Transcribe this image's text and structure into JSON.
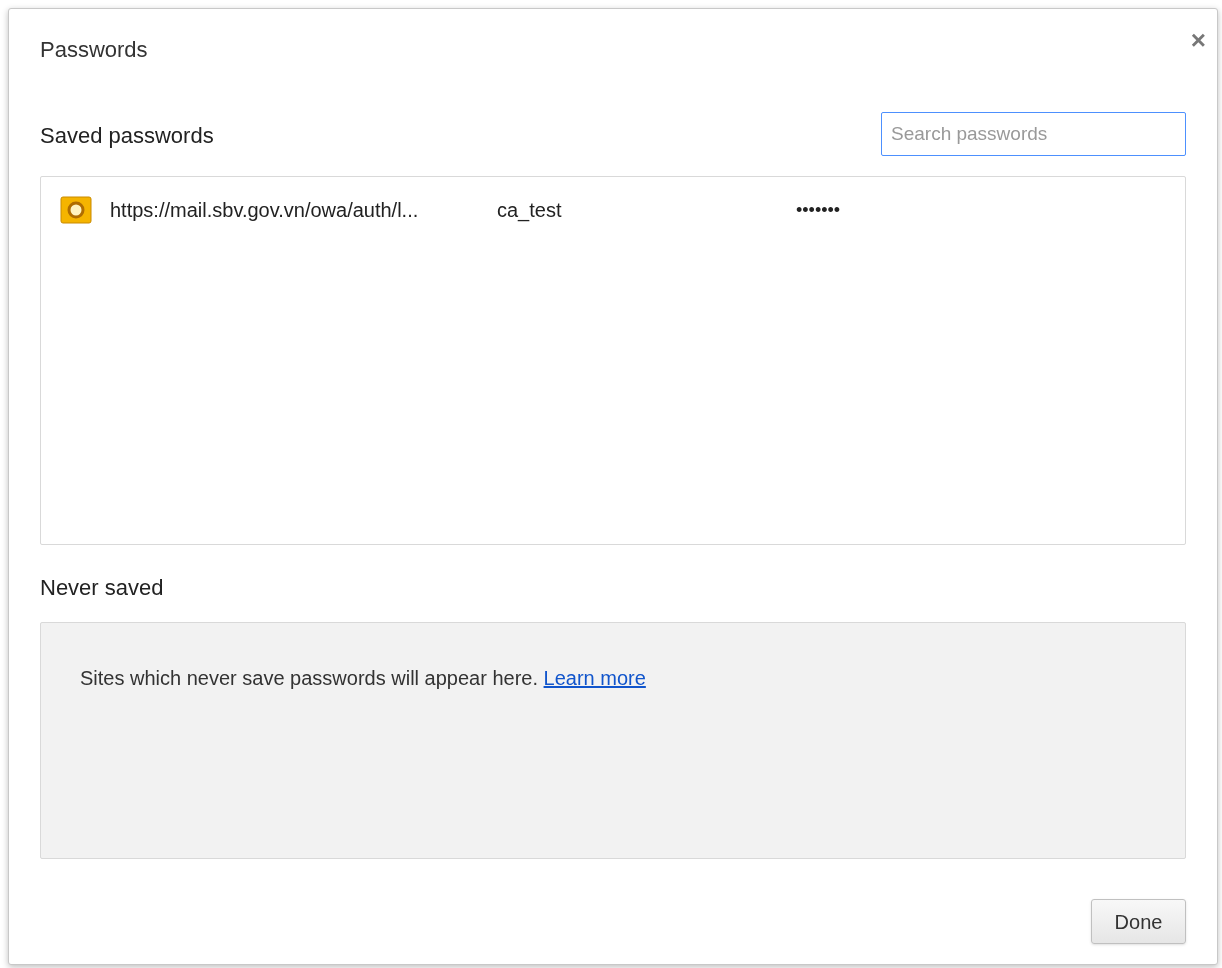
{
  "dialog": {
    "title": "Passwords",
    "close": "×"
  },
  "saved_passwords": {
    "heading": "Saved passwords",
    "search": {
      "placeholder": "Search passwords"
    },
    "rows": [
      {
        "site": "https://mail.sbv.gov.vn/owa/auth/l...",
        "username": "ca_test",
        "password": "•••••••"
      }
    ]
  },
  "never_saved": {
    "heading": "Never saved",
    "message": "Sites which never save passwords will appear here.",
    "link": "Learn more"
  },
  "buttons": [
    "Done"
  ]
}
